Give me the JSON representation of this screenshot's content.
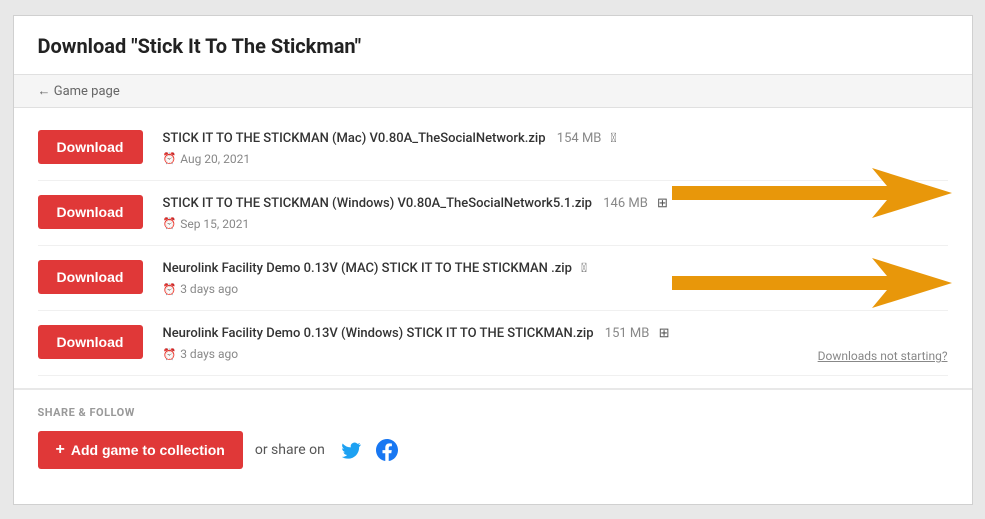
{
  "page": {
    "title_prefix": "Download ",
    "title_quoted": "\"Stick It To The Stickman\"",
    "back_label": "← Game page"
  },
  "downloads": [
    {
      "id": 1,
      "btn_label": "Download",
      "filename": "STICK IT TO THE STICKMAN (Mac) V0.80A_TheSocialNetwork.zip",
      "filesize": "154 MB",
      "platform": "mac",
      "date": "Aug 20, 2021"
    },
    {
      "id": 2,
      "btn_label": "Download",
      "filename": "STICK IT TO THE STICKMAN (Windows) V0.80A_TheSocialNetwork5.1.zip",
      "filesize": "146 MB",
      "platform": "windows",
      "date": "Sep 15, 2021"
    },
    {
      "id": 3,
      "btn_label": "Download",
      "filename": "Neurolink Facility Demo 0.13V (MAC) STICK IT TO THE STICKMAN .zip",
      "filesize": "",
      "platform": "mac",
      "date": "3 days ago"
    },
    {
      "id": 4,
      "btn_label": "Download",
      "filename": "Neurolink Facility Demo 0.13V (Windows) STICK IT TO THE STICKMAN.zip",
      "filesize": "151 MB",
      "platform": "windows",
      "date": "3 days ago"
    }
  ],
  "downloads_not_starting": "Downloads not starting?",
  "share": {
    "section_label": "SHARE & FOLLOW",
    "add_collection_label": "Add game to collection",
    "or_share_on": "or share on"
  }
}
